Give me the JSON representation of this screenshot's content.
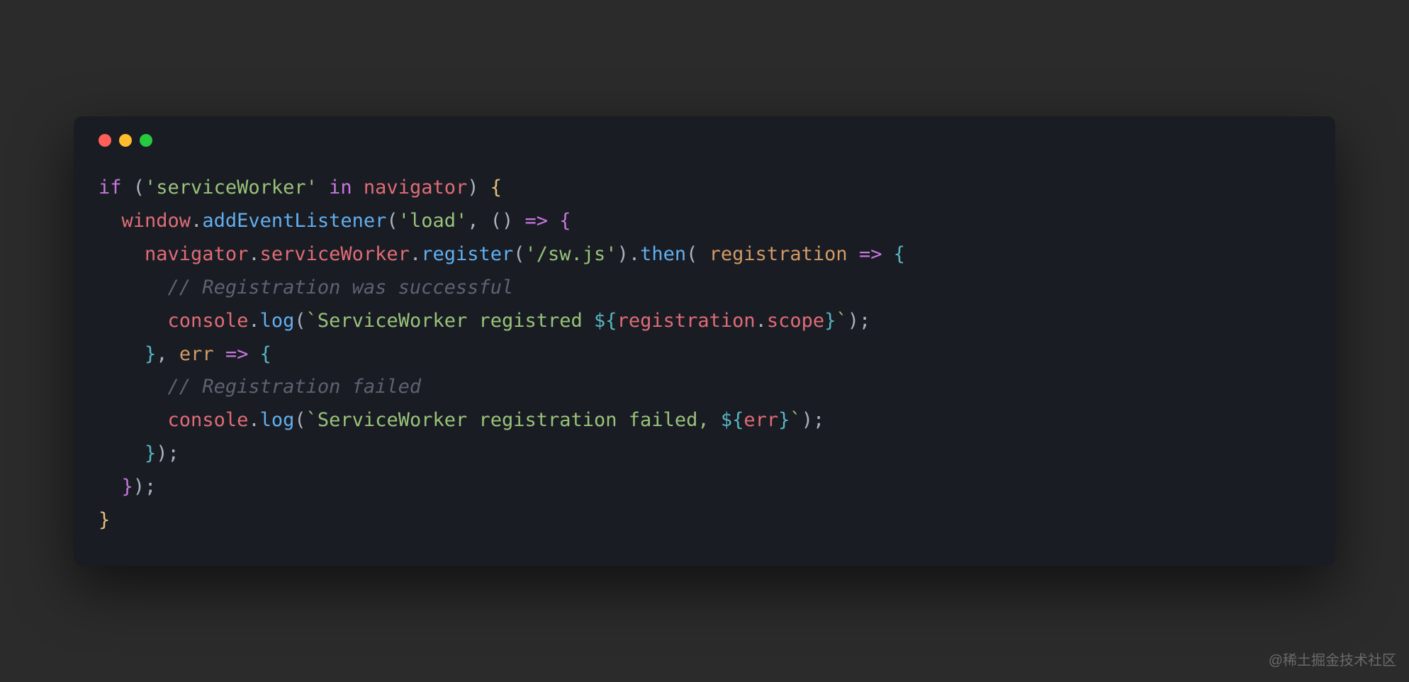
{
  "watermark": "@稀土掘金技术社区",
  "code": {
    "l1": {
      "t1": "if",
      "t2": " (",
      "t3": "'serviceWorker'",
      "t4": " ",
      "t5": "in",
      "t6": " ",
      "t7": "navigator",
      "t8": ") ",
      "t9": "{"
    },
    "l2": {
      "indent": "  ",
      "t1": "window",
      "t2": ".",
      "t3": "addEventListener",
      "t4": "(",
      "t5": "'load'",
      "t6": ", () ",
      "t7": "=>",
      "t8": " ",
      "t9": "{"
    },
    "l3": {
      "indent": "    ",
      "t1": "navigator",
      "t2": ".",
      "t3": "serviceWorker",
      "t4": ".",
      "t5": "register",
      "t6": "(",
      "t7": "'/sw.js'",
      "t8": ").",
      "t9": "then",
      "t10": "( ",
      "t11": "registration",
      "t12": " ",
      "t13": "=>",
      "t14": " ",
      "t15": "{"
    },
    "l4": {
      "indent": "      ",
      "t1": "// Registration was successful"
    },
    "l5": {
      "indent": "      ",
      "t1": "console",
      "t2": ".",
      "t3": "log",
      "t4": "(",
      "t5": "`ServiceWorker registred ",
      "t6": "${",
      "t7": "registration",
      "t8": ".",
      "t9": "scope",
      "t10": "}",
      "t11": "`",
      "t12": ");"
    },
    "l6": {
      "indent": "    ",
      "t1": "}",
      "t2": ", ",
      "t3": "err",
      "t4": " ",
      "t5": "=>",
      "t6": " ",
      "t7": "{"
    },
    "l7": {
      "indent": "      ",
      "t1": "// Registration failed"
    },
    "l8": {
      "indent": "      ",
      "t1": "console",
      "t2": ".",
      "t3": "log",
      "t4": "(",
      "t5": "`ServiceWorker registration failed, ",
      "t6": "${",
      "t7": "err",
      "t8": "}",
      "t9": "`",
      "t10": ");"
    },
    "l9": {
      "indent": "    ",
      "t1": "}",
      "t2": ");"
    },
    "l10": {
      "indent": "  ",
      "t1": "}",
      "t2": ");"
    },
    "l11": {
      "t1": "}"
    }
  }
}
